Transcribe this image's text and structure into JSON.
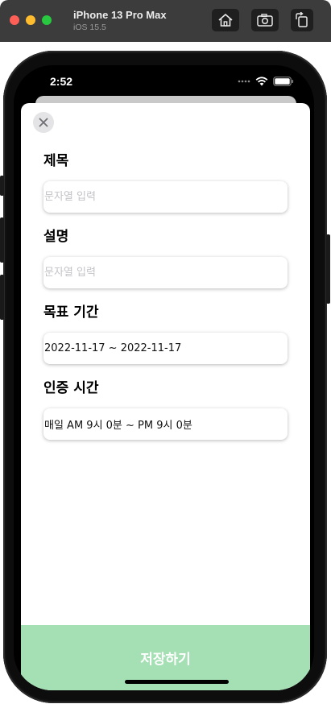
{
  "simulator": {
    "device_name": "iPhone 13 Pro Max",
    "os_version": "iOS 15.5",
    "buttons": [
      "home-icon",
      "screenshot-icon",
      "rotate-icon"
    ]
  },
  "status_bar": {
    "time": "2:52",
    "icons": [
      "signal-icon",
      "wifi-icon",
      "battery-icon"
    ]
  },
  "form": {
    "title": {
      "label": "제목",
      "placeholder": "문자열 입력",
      "value": ""
    },
    "description": {
      "label": "설명",
      "placeholder": "문자열 입력",
      "value": ""
    },
    "goal_period": {
      "label": "목표 기간",
      "value": "2022-11-17 ~ 2022-11-17"
    },
    "verify_time": {
      "label": "인증 시간",
      "value": "매일 AM 9시 0분 ~ PM 9시 0분"
    }
  },
  "save_button": {
    "label": "저장하기",
    "color": "#a4e0b4"
  },
  "colors": {
    "traffic_red": "#fe5f57",
    "traffic_yellow": "#febc2e",
    "traffic_green": "#28c840"
  }
}
